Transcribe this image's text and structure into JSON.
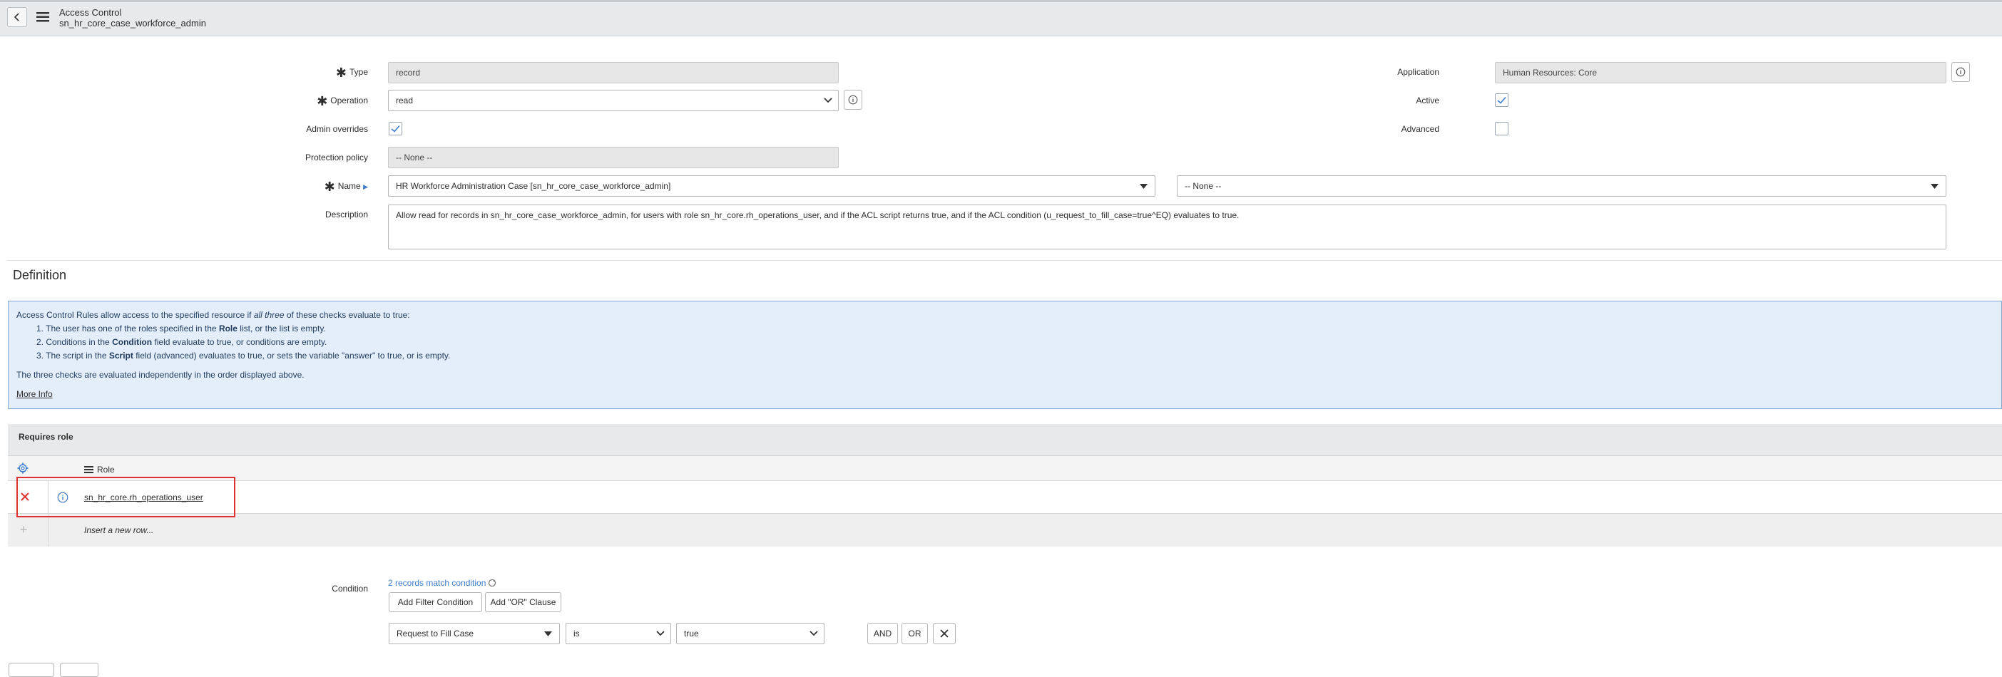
{
  "header": {
    "title": "Access Control",
    "subtitle": "sn_hr_core_case_workforce_admin"
  },
  "form": {
    "type": {
      "label": "Type",
      "value": "record"
    },
    "operation": {
      "label": "Operation",
      "value": "read"
    },
    "admin_overrides": {
      "label": "Admin overrides",
      "checked": true
    },
    "protection_policy": {
      "label": "Protection policy",
      "value": "-- None --"
    },
    "name": {
      "label": "Name",
      "table_value": "HR Workforce Administration Case [sn_hr_core_case_workforce_admin]",
      "field_value": "-- None --"
    },
    "description": {
      "label": "Description",
      "value": "Allow read for records in sn_hr_core_case_workforce_admin, for users with role sn_hr_core.rh_operations_user, and if the ACL script returns true, and if the ACL condition (u_request_to_fill_case=true^EQ) evaluates to true."
    },
    "application": {
      "label": "Application",
      "value": "Human Resources: Core"
    },
    "active": {
      "label": "Active",
      "checked": true
    },
    "advanced": {
      "label": "Advanced",
      "checked": false
    }
  },
  "definition": {
    "heading": "Definition",
    "intro_start": "Access Control Rules allow access to the specified resource if ",
    "intro_em": "all three",
    "intro_end": " of these checks evaluate to true:",
    "items": [
      {
        "num": "1. ",
        "pre": "The user has one of the roles specified in the ",
        "bold": "Role",
        "post": " list, or the list is empty."
      },
      {
        "num": "2. ",
        "pre": "Conditions in the ",
        "bold": "Condition",
        "post": " field evaluate to true, or conditions are empty."
      },
      {
        "num": "3. ",
        "pre": "The script in the ",
        "bold": "Script",
        "post": " field (advanced) evaluates to true, or sets the variable \"answer\" to true, or is empty."
      }
    ],
    "note": "The three checks are evaluated independently in the order displayed above.",
    "more_info": "More Info"
  },
  "requires_role": {
    "title": "Requires role",
    "column": "Role",
    "rows": [
      {
        "role": "sn_hr_core.rh_operations_user"
      }
    ],
    "insert_label": "Insert a new row..."
  },
  "condition": {
    "label": "Condition",
    "match_text": "2 records match condition",
    "add_filter": "Add Filter Condition",
    "add_or": "Add \"OR\" Clause",
    "field": "Request to Fill Case",
    "operator": "is",
    "value": "true",
    "and_label": "AND",
    "or_label": "OR"
  },
  "colors": {
    "accent": "#3d7cc9",
    "highlight": "#e03131",
    "info_bg": "#e4eefa"
  }
}
